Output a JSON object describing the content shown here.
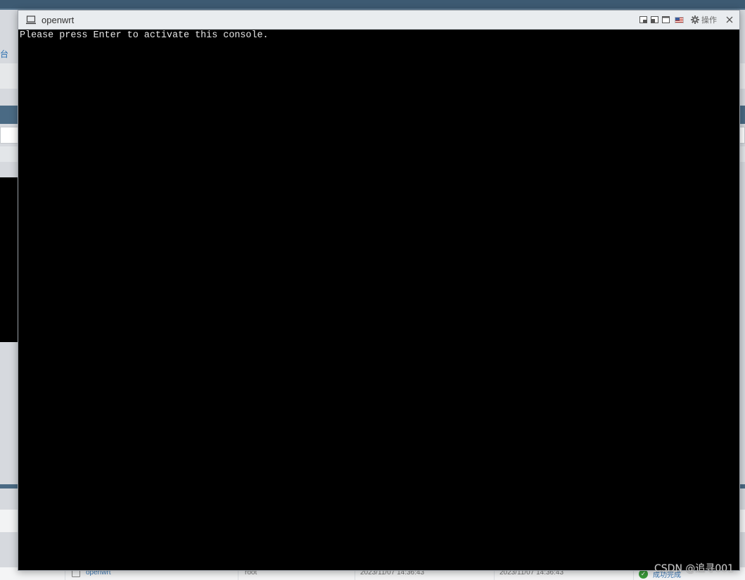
{
  "console": {
    "title": "openwrt",
    "actions_label": "操作",
    "terminal_text": "Please press Enter to activate this console.",
    "icons": {
      "title": "monitor-icon",
      "controls": [
        "pip-icon",
        "restore-icon",
        "maximize-icon",
        "us-flag-icon",
        "gear-icon",
        "close-icon"
      ]
    }
  },
  "background": {
    "left_text": "台",
    "task_row": {
      "name": "openwrt",
      "user": "root",
      "queued": "2023/11/07 14:36:43",
      "started": "2023/11/07 14:36:43",
      "status": "成功完成"
    }
  },
  "watermark": "CSDN @追寻001",
  "colors": {
    "terminal_bg": "#000000",
    "terminal_fg": "#e8e8e8",
    "titlebar_bg": "#e9ecef",
    "bg_topbar": "#3d5a72",
    "link": "#3c78b4",
    "success": "#3a9a3a"
  }
}
